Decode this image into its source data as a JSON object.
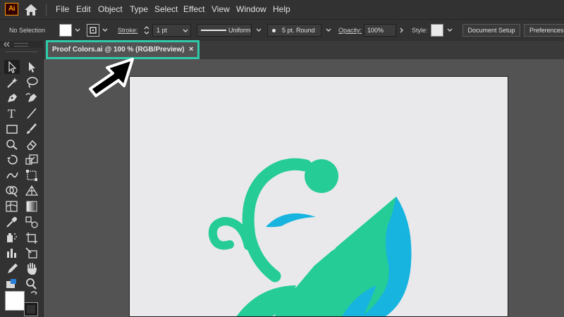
{
  "app": {
    "logo_text": "Ai"
  },
  "menu": [
    {
      "label": "File"
    },
    {
      "label": "Edit"
    },
    {
      "label": "Object"
    },
    {
      "label": "Type"
    },
    {
      "label": "Select"
    },
    {
      "label": "Effect"
    },
    {
      "label": "View"
    },
    {
      "label": "Window"
    },
    {
      "label": "Help"
    }
  ],
  "controlbar": {
    "selection": "No Selection",
    "stroke_label": "Stroke:",
    "stroke_weight": "1 pt",
    "profile": "Uniform",
    "brush": "5 pt. Round",
    "opacity_label": "Opacity:",
    "opacity_value": "100%",
    "style_label": "Style:",
    "document_setup": "Document Setup",
    "preferences": "Preferences"
  },
  "document_tab": {
    "title": "Proof Colors.ai @ 100 % (RGB/Preview)",
    "close": "×"
  },
  "colors": {
    "highlight": "#2fcaa9",
    "art_green": "#25cc96",
    "art_blue": "#16b4df",
    "artboard": "#e9e9ec",
    "ui_dark": "#323232",
    "workspace": "#535353"
  }
}
